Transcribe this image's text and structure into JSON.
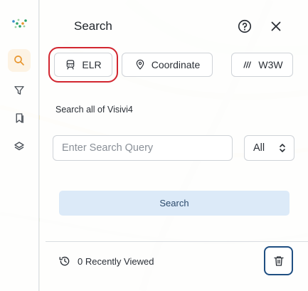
{
  "panel": {
    "title": "Search",
    "help_icon": "help-circle-icon",
    "close_icon": "close-icon"
  },
  "nav": {
    "logo_icon": "visivi-logo-icon",
    "items": [
      {
        "icon": "search-icon",
        "active": true
      },
      {
        "icon": "filter-icon",
        "active": false
      },
      {
        "icon": "bookmarks-icon",
        "active": false
      },
      {
        "icon": "layers-icon",
        "active": false
      }
    ]
  },
  "modes": {
    "elr_label": "ELR",
    "elr_icon": "train-icon",
    "coordinate_label": "Coordinate",
    "coordinate_icon": "map-pin-icon",
    "w3w_label": "W3W",
    "w3w_icon": "w3w-slashes-icon",
    "selected": "ELR"
  },
  "search": {
    "section_label": "Search all of Visivi4",
    "placeholder": "Enter Search Query",
    "value": "",
    "scope_value": "All",
    "button_label": "Search"
  },
  "recent": {
    "label": "0 Recently Viewed",
    "icon": "history-icon",
    "clear_icon": "trash-icon"
  },
  "colors": {
    "accent_orange": "#e8962e",
    "selection_red": "#d22630",
    "search_button_bg": "#dceaf8",
    "trash_border": "#1f4f82"
  }
}
